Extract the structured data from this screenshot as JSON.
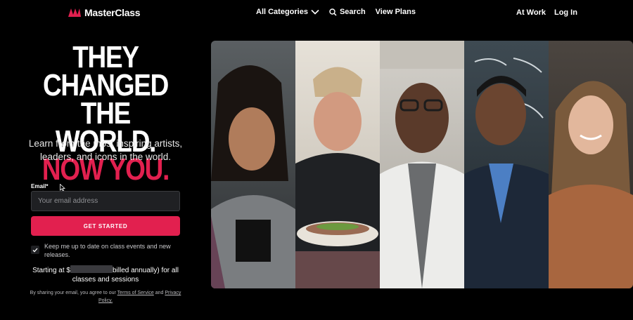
{
  "header": {
    "logo_text": "MasterClass",
    "nav": {
      "all_categories": "All Categories",
      "search": "Search",
      "view_plans": "View Plans",
      "at_work": "At Work",
      "log_in": "Log In"
    }
  },
  "hero": {
    "headline_line1": "THEY CHANGED",
    "headline_line2": "THE WORLD.",
    "headline_line3": "NOW YOU.",
    "subtext": "Learn from the most inspiring artists, leaders, and icons in the world."
  },
  "form": {
    "email_label": "Email*",
    "email_placeholder": "Your email address",
    "email_value": "",
    "cta_label": "GET STARTED",
    "checkbox_label": "Keep me up to date on class events and new releases.",
    "checkbox_checked": true
  },
  "pricing": {
    "prefix": "Starting at $",
    "suffix": "billed annually) for all classes and sessions"
  },
  "legal": {
    "prefix": "By sharing your email, you agree to our",
    "terms": "Terms of Service",
    "and": "and",
    "privacy": "Privacy Policy."
  },
  "colors": {
    "accent": "#e2204f",
    "background": "#000000",
    "input_bg": "#1f2023"
  },
  "icons": {
    "logo": "masterclass-logo-icon",
    "chevron": "chevron-down-icon",
    "search": "search-icon",
    "checkbox": "checkmark-icon",
    "cursor": "mouse-cursor-icon"
  },
  "hero_image": {
    "panels": [
      "portrait-1",
      "portrait-2",
      "portrait-3",
      "portrait-4",
      "portrait-5"
    ]
  }
}
